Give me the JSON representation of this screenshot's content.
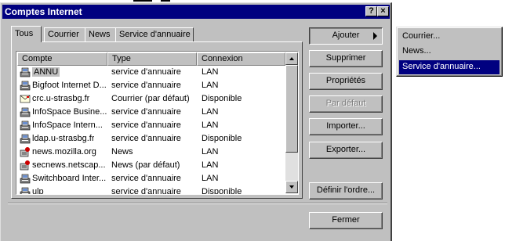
{
  "window": {
    "title": "Comptes Internet",
    "help_btn": "?",
    "close_btn": "×"
  },
  "tabs": [
    "Tous",
    "Courrier",
    "News",
    "Service d'annuaire"
  ],
  "columns": [
    "Compte",
    "Type",
    "Connexion"
  ],
  "rows": [
    {
      "icon": "directory-icon",
      "name": "ANNU",
      "type": "service d'annuaire",
      "conn": "LAN"
    },
    {
      "icon": "directory-icon",
      "name": "Bigfoot Internet D...",
      "type": "service d'annuaire",
      "conn": "LAN"
    },
    {
      "icon": "mail-icon",
      "name": "crc.u-strasbg.fr",
      "type": "Courrier (par défaut)",
      "conn": "Disponible"
    },
    {
      "icon": "directory-icon",
      "name": "InfoSpace Busine...",
      "type": "service d'annuaire",
      "conn": "LAN"
    },
    {
      "icon": "directory-icon",
      "name": "InfoSpace Intern...",
      "type": "service d'annuaire",
      "conn": "LAN"
    },
    {
      "icon": "directory-icon",
      "name": "ldap.u-strasbg.fr",
      "type": "service d'annuaire",
      "conn": "Disponible"
    },
    {
      "icon": "news-icon",
      "name": "news.mozilla.org",
      "type": "News",
      "conn": "LAN"
    },
    {
      "icon": "news-icon",
      "name": "secnews.netscap...",
      "type": "News (par défaut)",
      "conn": "LAN"
    },
    {
      "icon": "directory-icon",
      "name": "Switchboard Inter...",
      "type": "service d'annuaire",
      "conn": "LAN"
    },
    {
      "icon": "directory-icon",
      "name": "ulp",
      "type": "service d'annuaire",
      "conn": "Disponible"
    }
  ],
  "buttons": {
    "ajouter": "Ajouter",
    "supprimer": "Supprimer",
    "proprietes": "Propriétés",
    "par_defaut": "Par défaut",
    "importer": "Importer...",
    "exporter": "Exporter...",
    "definir_ordre": "Définir l'ordre...",
    "fermer": "Fermer"
  },
  "menu": [
    "Courrier...",
    "News...",
    "Service d'annuaire..."
  ],
  "colors": {
    "title_bar": "#000080",
    "highlight": "#000080",
    "face": "#c0c0c0"
  }
}
